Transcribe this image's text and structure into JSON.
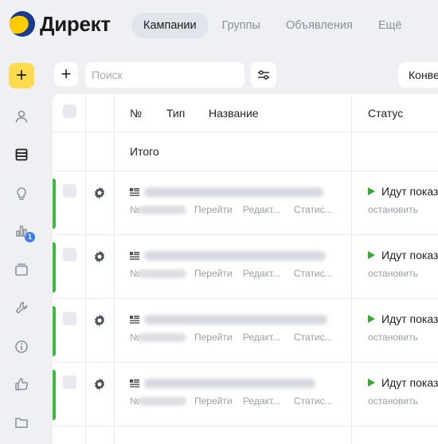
{
  "header": {
    "logo_text": "Директ",
    "nav": [
      {
        "label": "Кампании",
        "active": true
      },
      {
        "label": "Группы",
        "active": false
      },
      {
        "label": "Объявления",
        "active": false
      },
      {
        "label": "Ещё",
        "active": false
      }
    ]
  },
  "sidebar": {
    "add_label": "+",
    "notification_count": "1",
    "items": [
      "user-icon",
      "campaigns-icon",
      "lightbulb-icon",
      "stats-icon",
      "library-icon",
      "tools-icon",
      "info-icon",
      "like-icon",
      "folder-icon"
    ]
  },
  "toolbar": {
    "add_label": "+",
    "search_placeholder": "Поиск",
    "conversion_label": "Конве"
  },
  "table": {
    "columns": {
      "num": "№",
      "type": "Тип",
      "name": "Название",
      "status": "Статус"
    },
    "total_label": "Итого",
    "rows": [
      {
        "num_prefix": "№",
        "actions": [
          "Перейти",
          "Редакт...",
          "Статис..."
        ],
        "status": "Идут показ",
        "stop": "остановить"
      },
      {
        "num_prefix": "№",
        "actions": [
          "Перейти",
          "Редакт...",
          "Статис..."
        ],
        "status": "Идут показ",
        "stop": "остановить"
      },
      {
        "num_prefix": "№",
        "actions": [
          "Перейти",
          "Редакт...",
          "Статис..."
        ],
        "status": "Идут показ",
        "stop": "остановить"
      },
      {
        "num_prefix": "№",
        "actions": [
          "Перейти",
          "Редакт...",
          "Статис..."
        ],
        "status": "Идут показ",
        "stop": "остановить"
      }
    ]
  },
  "colors": {
    "accent_yellow": "#ffdb4d",
    "status_green": "#3fbb3d",
    "badge_blue": "#3a7cf6"
  }
}
